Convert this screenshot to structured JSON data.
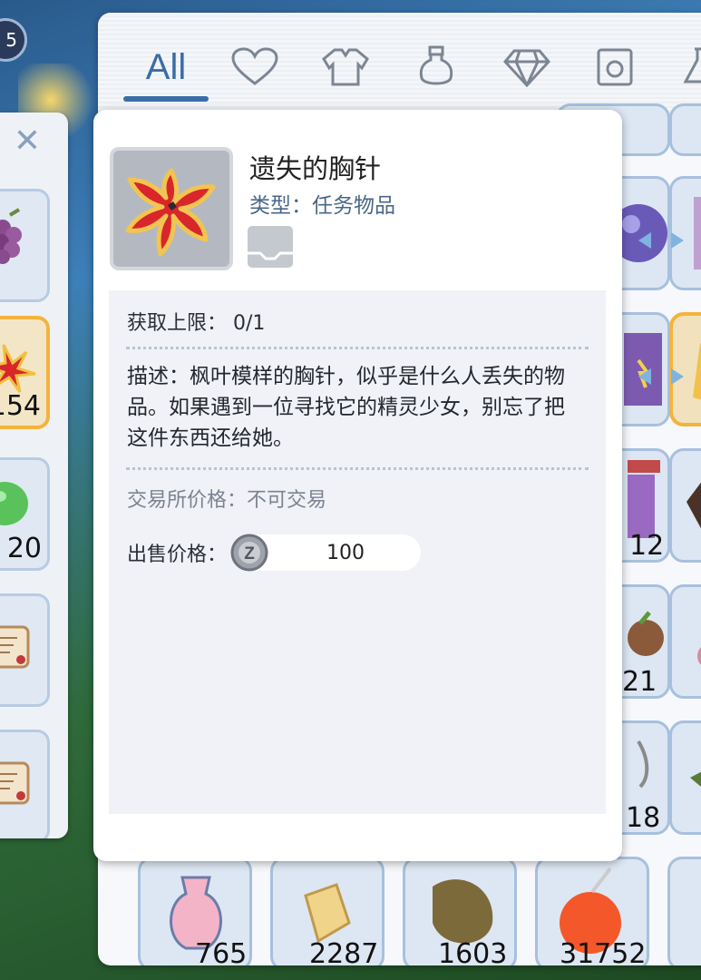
{
  "background": {
    "level_badge": "5"
  },
  "left_panel": {
    "close_icon": "close-icon",
    "slots": [
      {
        "icon": "grape-icon",
        "count": ""
      },
      {
        "icon": "brooch-icon",
        "count": "154",
        "selected": true
      },
      {
        "icon": "green-jelly-icon",
        "count": "20"
      },
      {
        "icon": "scroll-icon",
        "count": ""
      },
      {
        "icon": "scroll-icon",
        "count": ""
      }
    ]
  },
  "inventory": {
    "tabs": [
      {
        "label": "All",
        "active": true
      },
      {
        "icon": "heart-icon"
      },
      {
        "icon": "armor-icon"
      },
      {
        "icon": "potion-icon"
      },
      {
        "icon": "gem-icon"
      },
      {
        "icon": "card-icon"
      },
      {
        "icon": "flask-icon"
      }
    ],
    "right_column_counts": [
      "",
      "",
      "",
      "12",
      "21",
      "18"
    ],
    "bottom_row_counts": [
      "765",
      "2287",
      "1603",
      "31752"
    ]
  },
  "detail": {
    "name": "遗失的胸针",
    "type_label": "类型：",
    "type_value": "任务物品",
    "limit_label": "获取上限：",
    "limit_value": "0/1",
    "description": "描述：枫叶模样的胸针，似乎是什么人丢失的物品。如果遇到一位寻找它的精灵少女，别忘了把这件东西还给她。",
    "trade_label": "交易所价格：",
    "trade_value": "不可交易",
    "sell_label": "出售价格：",
    "sell_value": "100",
    "currency_letter": "Z"
  },
  "colors": {
    "accent": "#3a6da8",
    "selected_border": "#f4b33c",
    "item_red": "#d8262b"
  }
}
